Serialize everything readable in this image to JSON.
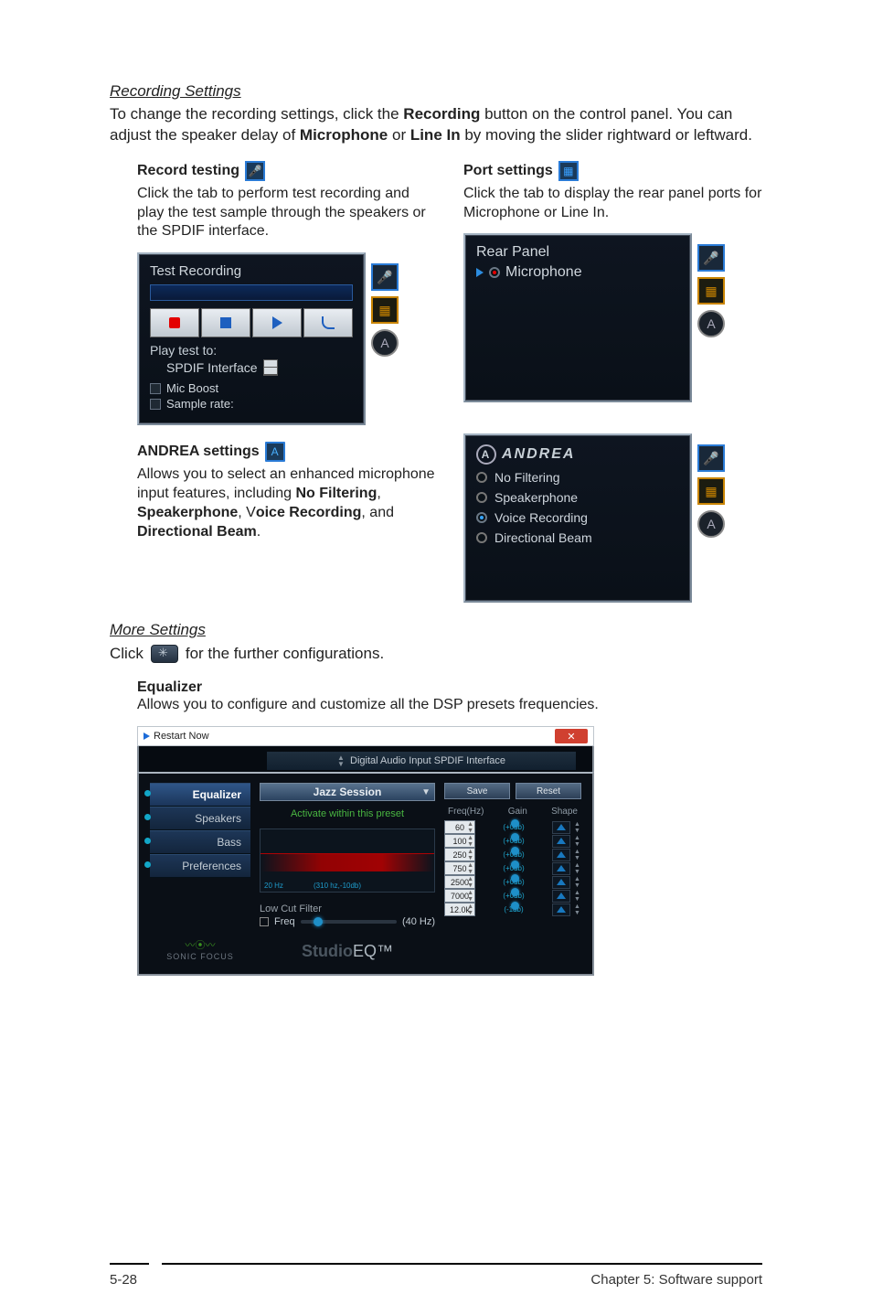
{
  "section1": {
    "title": "Recording Settings",
    "intro_pre": "To change the recording settings, click the ",
    "intro_bold1": "Recording",
    "intro_mid1": " button on the control panel. You can adjust the speaker delay of ",
    "intro_bold2": "Microphone",
    "intro_mid2": " or ",
    "intro_bold3": "Line In",
    "intro_post": " by moving the slider rightward or leftward."
  },
  "record_testing": {
    "title": "Record testing",
    "desc": "Click the tab to perform test recording and play the test sample through the speakers or the SPDIF interface.",
    "panel_title": "Test Recording",
    "play_label": "Play test to:",
    "spdif": "SPDIF Interface",
    "mic_boost": "Mic Boost",
    "sample_rate": "Sample rate:"
  },
  "port_settings": {
    "title": "Port settings",
    "desc": "Click the tab to display the rear panel ports for Microphone or Line In.",
    "panel_title": "Rear Panel",
    "microphone": "Microphone"
  },
  "andrea": {
    "title": "ANDREA settings",
    "desc_pre": "Allows you to select an enhanced microphone input features, including ",
    "b1": "No Filtering",
    "s1": ", ",
    "b2": "Speakerphone",
    "s2": ", V",
    "b3": "oice Recording",
    "s3": ", and ",
    "b4": "Directional Beam",
    "s4": ".",
    "logo": "ANDREA",
    "options": [
      "No Filtering",
      "Speakerphone",
      "Voice Recording",
      "Directional Beam"
    ]
  },
  "more": {
    "title": "More Settings",
    "click_pre": "Click ",
    "click_post": " for the further configurations.",
    "eq_title": "Equalizer",
    "eq_desc": "Allows you to configure and customize all the DSP presets frequencies."
  },
  "eq": {
    "window_title": "Restart Now",
    "spdif_bar": "Digital Audio Input SPDIF Interface",
    "sidebar": [
      "Equalizer",
      "Speakers",
      "Bass",
      "Preferences"
    ],
    "sonic": "SONIC FOCUS",
    "preset": "Jazz Session",
    "activate": "Activate within this preset",
    "axis1": "20 Hz",
    "axis2": "(310 hz,-10db)",
    "lowcut_title": "Low Cut Filter",
    "lowcut_freq_label": "Freq",
    "lowcut_freq_val": "(40 Hz)",
    "studio1": "Studio",
    "studio2": "EQ™",
    "save": "Save",
    "reset": "Reset",
    "headers": [
      "Freq(Hz)",
      "Gain",
      "Shape"
    ],
    "rows": [
      {
        "freq": "60",
        "gain": "(+0db)"
      },
      {
        "freq": "100",
        "gain": "(+0db)"
      },
      {
        "freq": "250",
        "gain": "(+0db)"
      },
      {
        "freq": "750",
        "gain": "(+0db)"
      },
      {
        "freq": "2500",
        "gain": "(+0db)"
      },
      {
        "freq": "7000",
        "gain": "(+0db)"
      },
      {
        "freq": "12.0k",
        "gain": "(-1db)"
      }
    ]
  },
  "footer": {
    "left": "5-28",
    "right": "Chapter 5: Software support"
  }
}
